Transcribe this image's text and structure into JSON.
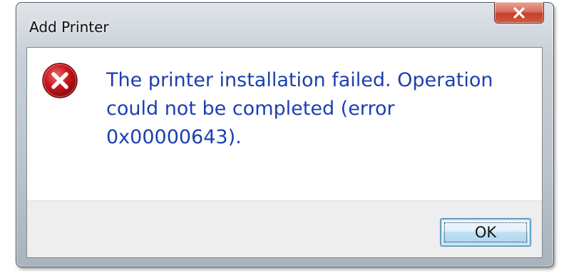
{
  "window": {
    "title": "Add Printer",
    "close_icon": "close-icon"
  },
  "dialog": {
    "icon": "error-icon",
    "message": "The printer installation failed. Operation could not be completed (error 0x00000643).",
    "ok_label": "OK"
  },
  "colors": {
    "message_text": "#1c3fb0",
    "close_button": "#c4412a",
    "error_icon": "#c8151b",
    "ok_button_border": "#3c7fb1"
  }
}
